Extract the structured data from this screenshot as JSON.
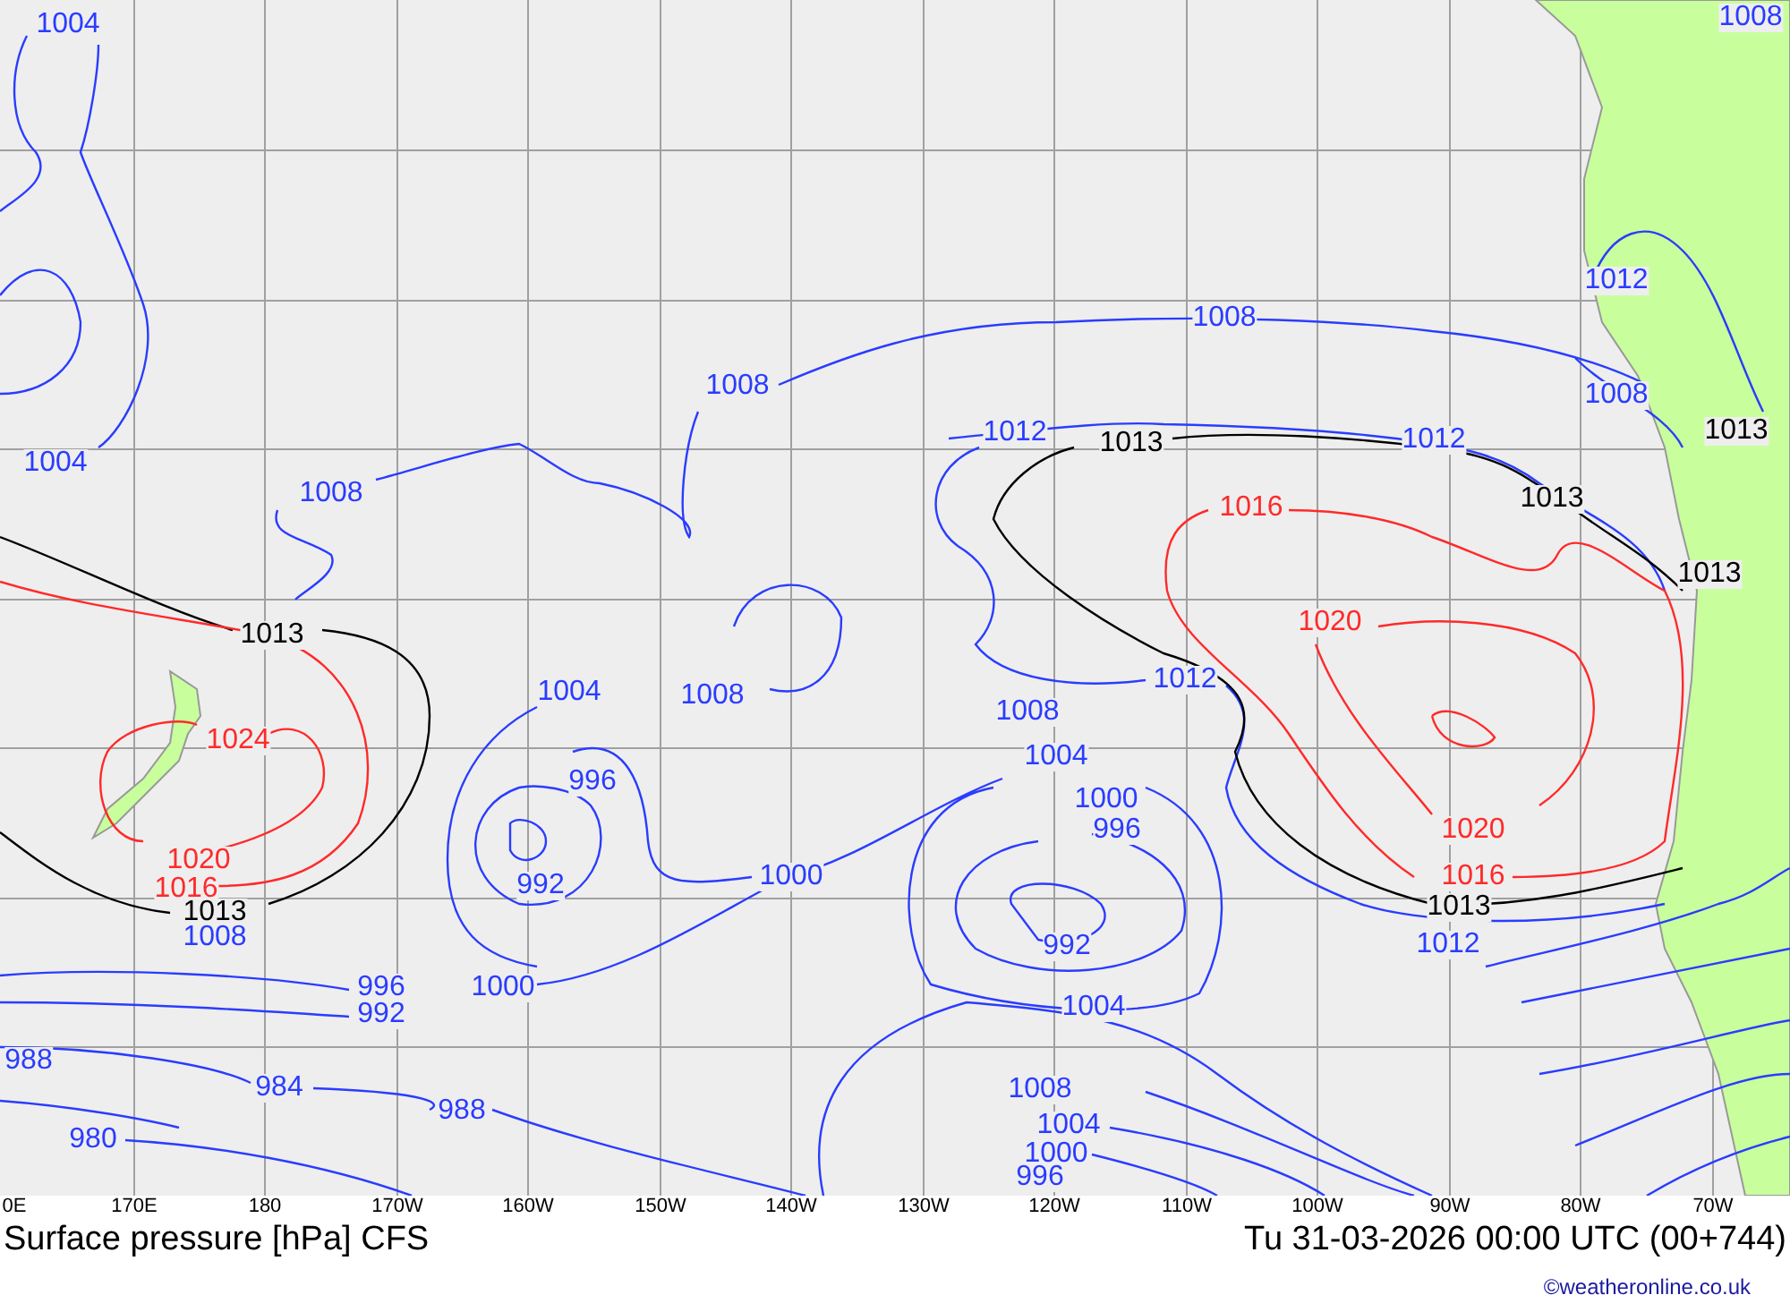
{
  "map": {
    "contour_labels": [
      {
        "text": "1004",
        "color": "#2a3cff"
      },
      {
        "text": "1008",
        "color": "#2a3cff"
      },
      {
        "text": "1012",
        "color": "#2a3cff"
      },
      {
        "text": "1008",
        "color": "#2a3cff"
      },
      {
        "text": "1008",
        "color": "#2a3cff"
      },
      {
        "text": "1008",
        "color": "#2a3cff"
      },
      {
        "text": "1012",
        "color": "#2a3cff"
      },
      {
        "text": "1013",
        "color": "#000000"
      },
      {
        "text": "1012",
        "color": "#2a3cff"
      },
      {
        "text": "1013",
        "color": "#000000"
      },
      {
        "text": "1004",
        "color": "#2a3cff"
      },
      {
        "text": "1008",
        "color": "#2a3cff"
      },
      {
        "text": "1016",
        "color": "#ff2a2a"
      },
      {
        "text": "1013",
        "color": "#000000"
      },
      {
        "text": "1013",
        "color": "#000000"
      },
      {
        "text": "1020",
        "color": "#ff2a2a"
      },
      {
        "text": "1013",
        "color": "#000000"
      },
      {
        "text": "1012",
        "color": "#2a3cff"
      },
      {
        "text": "1004",
        "color": "#2a3cff"
      },
      {
        "text": "1008",
        "color": "#2a3cff"
      },
      {
        "text": "1008",
        "color": "#2a3cff"
      },
      {
        "text": "1024",
        "color": "#ff2a2a"
      },
      {
        "text": "1004",
        "color": "#2a3cff"
      },
      {
        "text": "996",
        "color": "#2a3cff"
      },
      {
        "text": "1000",
        "color": "#2a3cff"
      },
      {
        "text": "996",
        "color": "#2a3cff"
      },
      {
        "text": "1020",
        "color": "#ff2a2a"
      },
      {
        "text": "1020",
        "color": "#ff2a2a"
      },
      {
        "text": "1016",
        "color": "#ff2a2a"
      },
      {
        "text": "992",
        "color": "#2a3cff"
      },
      {
        "text": "1000",
        "color": "#2a3cff"
      },
      {
        "text": "1016",
        "color": "#ff2a2a"
      },
      {
        "text": "1013",
        "color": "#000000"
      },
      {
        "text": "1013",
        "color": "#000000"
      },
      {
        "text": "1008",
        "color": "#2a3cff"
      },
      {
        "text": "992",
        "color": "#2a3cff"
      },
      {
        "text": "1012",
        "color": "#2a3cff"
      },
      {
        "text": "996",
        "color": "#2a3cff"
      },
      {
        "text": "1000",
        "color": "#2a3cff"
      },
      {
        "text": "1004",
        "color": "#2a3cff"
      },
      {
        "text": "992",
        "color": "#2a3cff"
      },
      {
        "text": "988",
        "color": "#2a3cff"
      },
      {
        "text": "984",
        "color": "#2a3cff"
      },
      {
        "text": "1008",
        "color": "#2a3cff"
      },
      {
        "text": "988",
        "color": "#2a3cff"
      },
      {
        "text": "1004",
        "color": "#2a3cff"
      },
      {
        "text": "980",
        "color": "#2a3cff"
      },
      {
        "text": "1000",
        "color": "#2a3cff"
      },
      {
        "text": "996",
        "color": "#2a3cff"
      }
    ]
  },
  "longitude_labels": [
    "0E",
    "170E",
    "180",
    "170W",
    "160W",
    "150W",
    "140W",
    "130W",
    "120W",
    "110W",
    "100W",
    "90W",
    "80W",
    "70W"
  ],
  "title": "Surface pressure [hPa] CFS",
  "valid_time": "Tu 31-03-2026 00:00 UTC (00+744)",
  "credit": "©weatheronline.co.uk"
}
